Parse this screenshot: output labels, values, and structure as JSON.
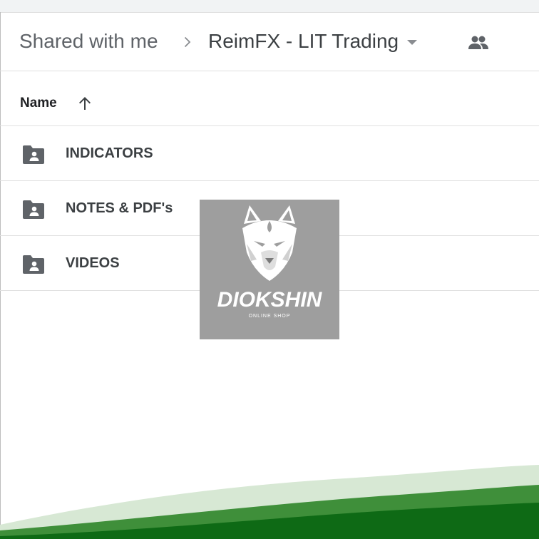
{
  "breadcrumb": {
    "root": "Shared with me",
    "separator_icon": "chevron-right-icon",
    "current": "ReimFX - LIT Trading",
    "dropdown_icon": "caret-down-icon",
    "share_icon": "people-icon"
  },
  "list": {
    "column_header": "Name",
    "sort_icon": "arrow-up-icon",
    "items": [
      {
        "name": "INDICATORS",
        "icon": "shared-folder-icon"
      },
      {
        "name": "NOTES & PDF's",
        "icon": "shared-folder-icon"
      },
      {
        "name": "VIDEOS",
        "icon": "shared-folder-icon"
      }
    ]
  },
  "watermark": {
    "brand": "DIOKSHIN",
    "subtitle": "ONLINE SHOP",
    "icon": "wolf-head-icon"
  },
  "colors": {
    "text_primary": "#3c4043",
    "text_secondary": "#5f6368",
    "icon_gray": "#5f6368",
    "divider": "#e0e0e0",
    "watermark_bg": "#9e9e9e",
    "wave_light": "#d7e8d4",
    "wave_mid": "#3f8f3a",
    "wave_dark": "#0e6a15"
  }
}
